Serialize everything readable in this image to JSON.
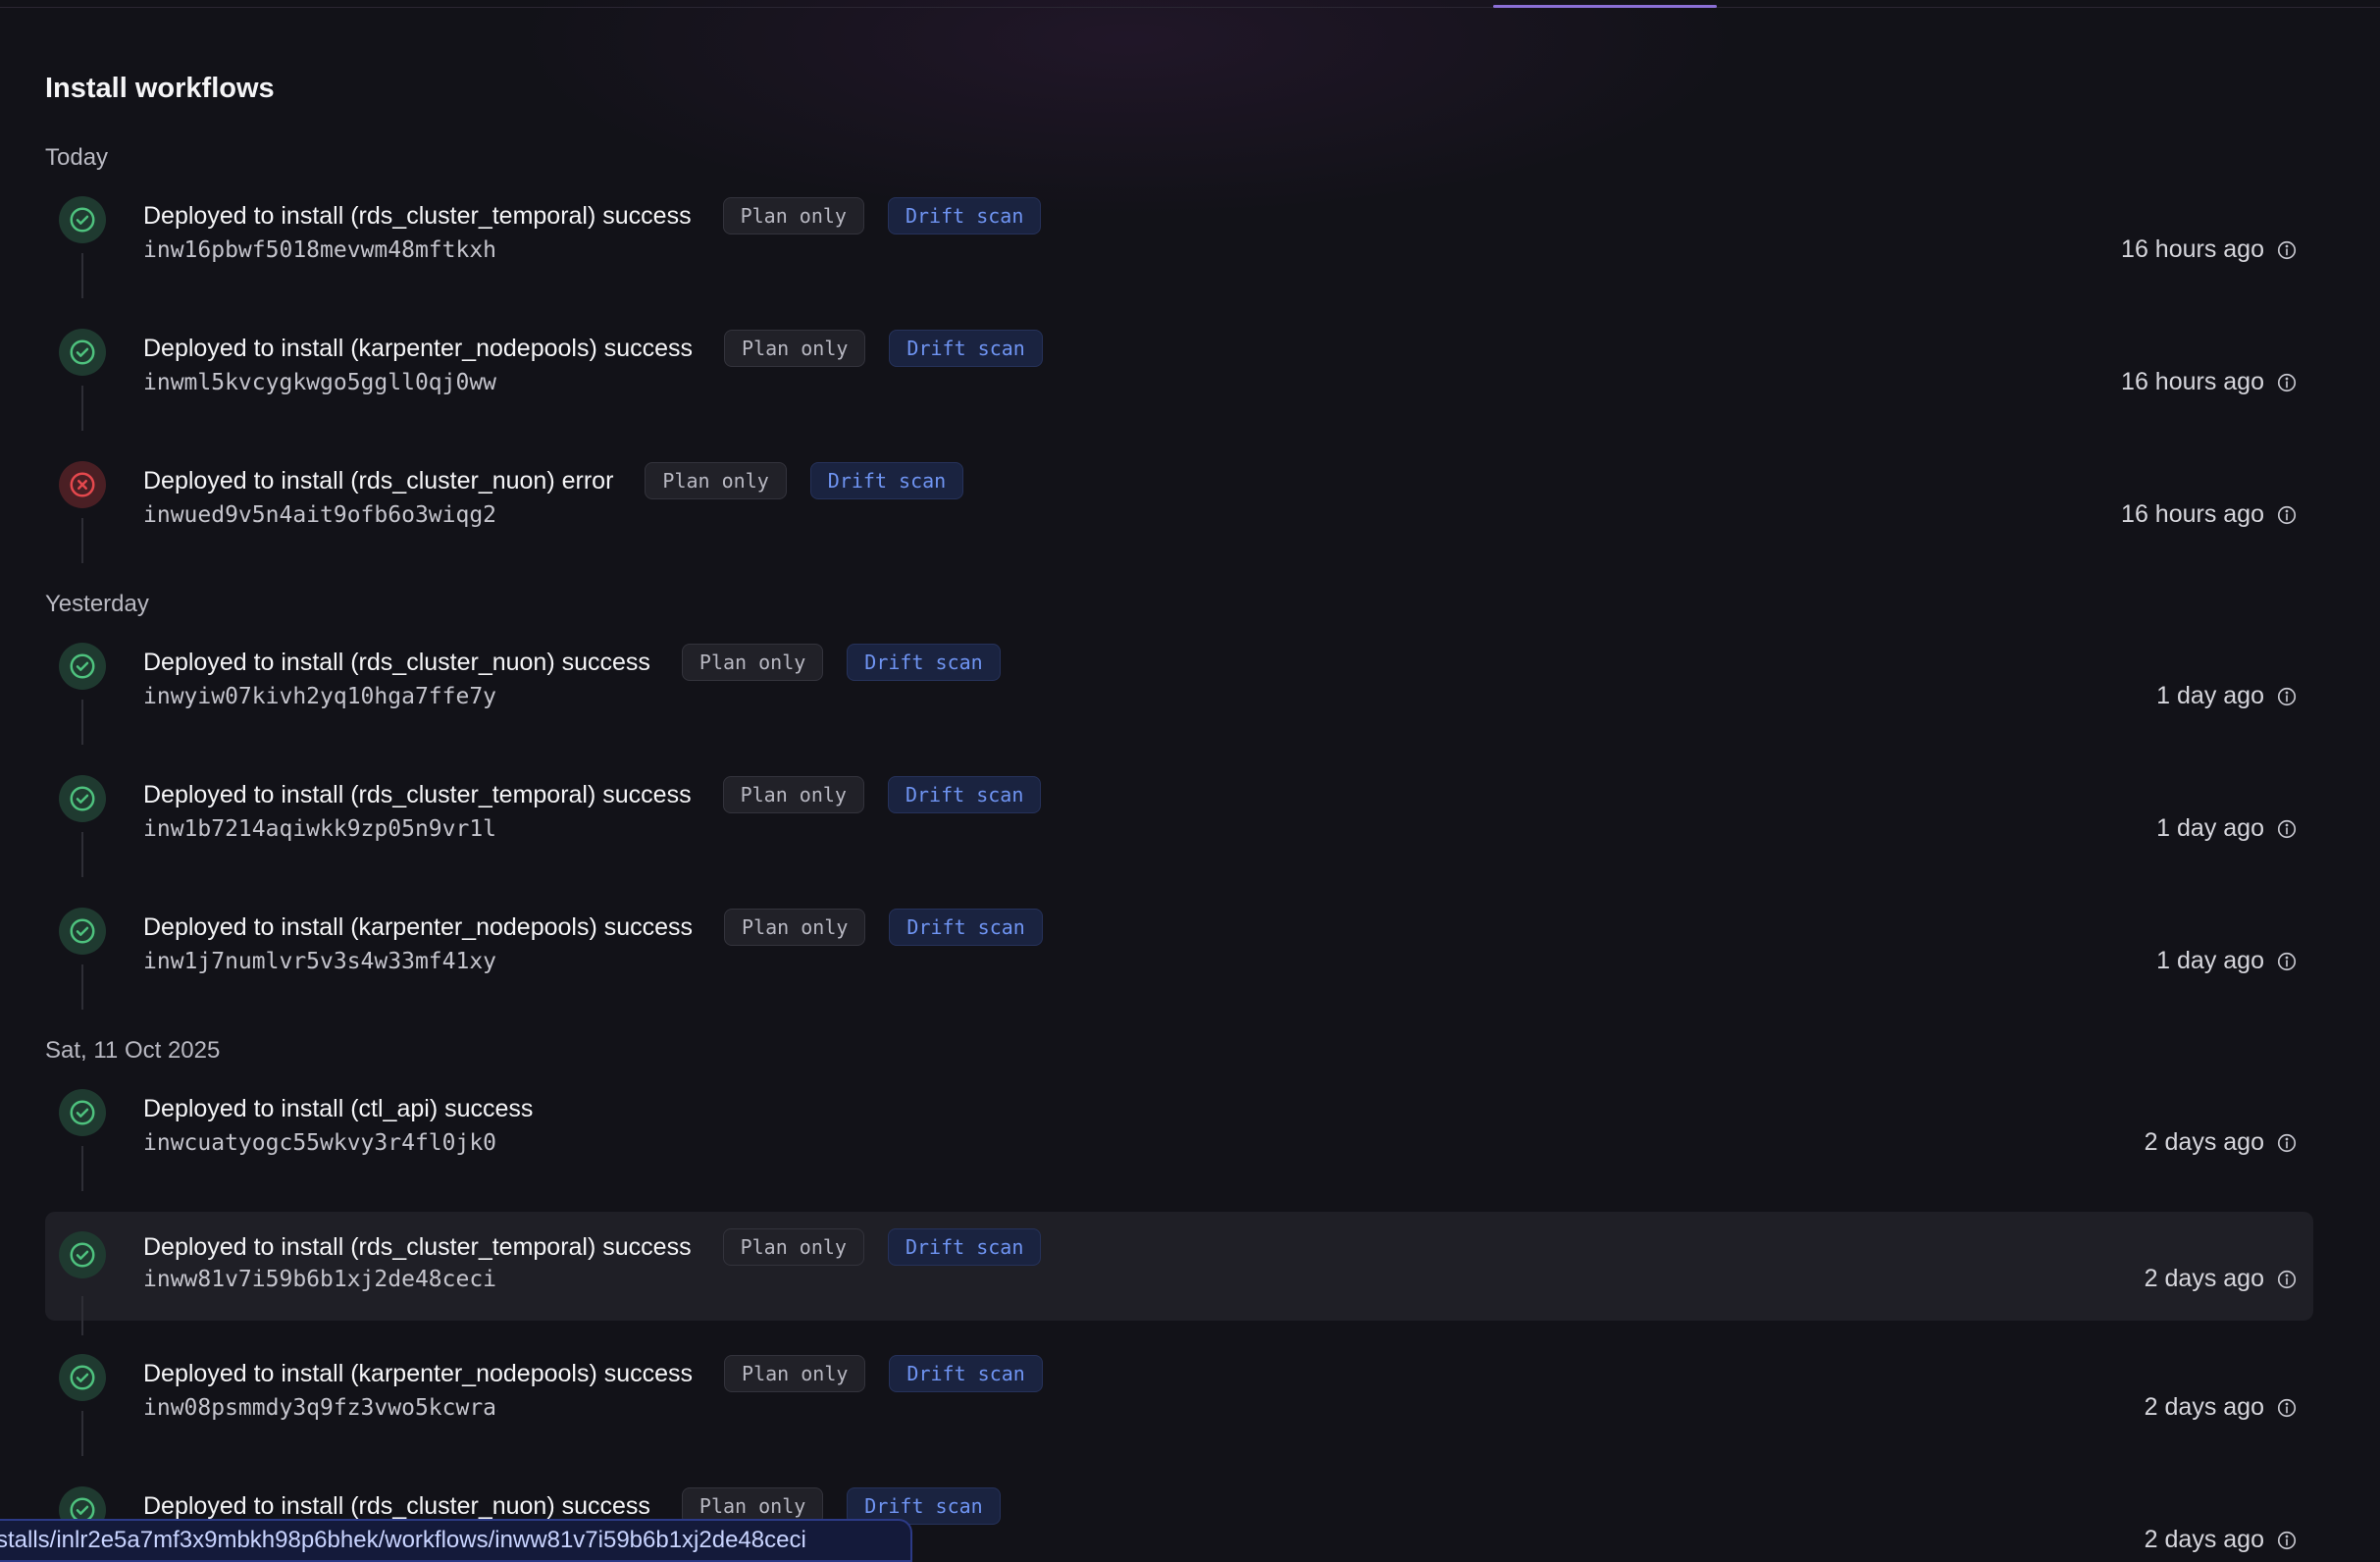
{
  "section_title": "Install workflows",
  "colors": {
    "success": "#4ec27e",
    "error": "#e5484d",
    "drift_text": "#6f94f2",
    "accent_tab": "#8b6fd6"
  },
  "icons": {
    "success": "check-circle-icon",
    "error": "x-circle-icon",
    "info": "info-icon"
  },
  "groups": [
    {
      "label": "Today",
      "items": [
        {
          "title": "Deployed to install (rds_cluster_temporal) success",
          "id": "inw16pbwf5018mevwm48mftkxh",
          "status": "success",
          "plan_label": "Plan only",
          "drift_label": "Drift scan",
          "time": "16 hours ago"
        },
        {
          "title": "Deployed to install (karpenter_nodepools) success",
          "id": "inwml5kvcygkwgo5ggll0qj0ww",
          "status": "success",
          "plan_label": "Plan only",
          "drift_label": "Drift scan",
          "time": "16 hours ago"
        },
        {
          "title": "Deployed to install (rds_cluster_nuon) error",
          "id": "inwued9v5n4ait9ofb6o3wiqg2",
          "status": "error",
          "plan_label": "Plan only",
          "drift_label": "Drift scan",
          "time": "16 hours ago"
        }
      ]
    },
    {
      "label": "Yesterday",
      "items": [
        {
          "title": "Deployed to install (rds_cluster_nuon) success",
          "id": "inwyiw07kivh2yq10hga7ffe7y",
          "status": "success",
          "plan_label": "Plan only",
          "drift_label": "Drift scan",
          "time": "1 day ago"
        },
        {
          "title": "Deployed to install (rds_cluster_temporal) success",
          "id": "inw1b7214aqiwkk9zp05n9vr1l",
          "status": "success",
          "plan_label": "Plan only",
          "drift_label": "Drift scan",
          "time": "1 day ago"
        },
        {
          "title": "Deployed to install (karpenter_nodepools) success",
          "id": "inw1j7numlvr5v3s4w33mf41xy",
          "status": "success",
          "plan_label": "Plan only",
          "drift_label": "Drift scan",
          "time": "1 day ago"
        }
      ]
    },
    {
      "label": "Sat, 11 Oct 2025",
      "items": [
        {
          "title": "Deployed to install (ctl_api) success",
          "id": "inwcuatyogc55wkvy3r4fl0jk0",
          "status": "success",
          "plan_label": "",
          "drift_label": "",
          "time": "2 days ago"
        },
        {
          "title": "Deployed to install (rds_cluster_temporal) success",
          "id": "inww81v7i59b6b1xj2de48ceci",
          "status": "success",
          "plan_label": "Plan only",
          "drift_label": "Drift scan",
          "time": "2 days ago",
          "highlighted": true
        },
        {
          "title": "Deployed to install (karpenter_nodepools) success",
          "id": "inw08psmmdy3q9fz3vwo5kcwra",
          "status": "success",
          "plan_label": "Plan only",
          "drift_label": "Drift scan",
          "time": "2 days ago"
        },
        {
          "title": "Deployed to install (rds_cluster_nuon) success",
          "id": "",
          "status": "success",
          "plan_label": "Plan only",
          "drift_label": "Drift scan",
          "time": "2 days ago"
        }
      ]
    }
  ],
  "status_bar_url": "stalls/inlr2e5a7mf3x9mbkh98p6bhek/workflows/inww81v7i59b6b1xj2de48ceci"
}
